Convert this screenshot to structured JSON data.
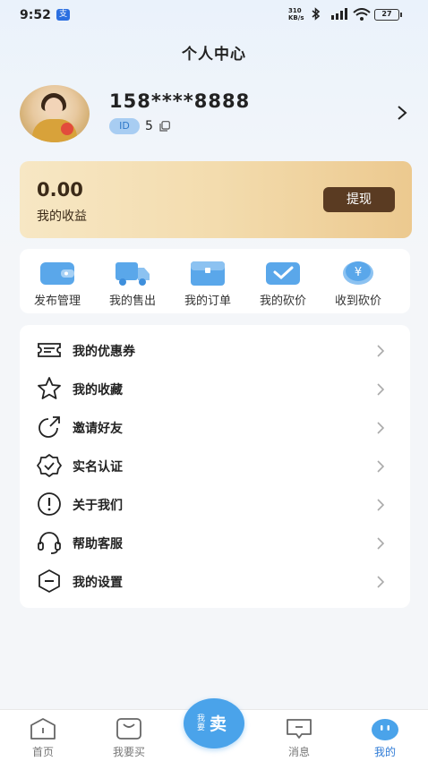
{
  "status": {
    "time": "9:52",
    "net_speed_top": "310",
    "net_speed_bottom": "KB/s",
    "battery": "27"
  },
  "page_title": "个人中心",
  "profile": {
    "phone": "158****8888",
    "id_label": "ID",
    "id_value": "5"
  },
  "earnings": {
    "amount": "0.00",
    "label": "我的收益",
    "withdraw": "提现"
  },
  "quick_actions": [
    {
      "label": "发布管理",
      "icon": "wallet-icon"
    },
    {
      "label": "我的售出",
      "icon": "truck-icon"
    },
    {
      "label": "我的订单",
      "icon": "box-icon"
    },
    {
      "label": "我的砍价",
      "icon": "check-folder-icon"
    },
    {
      "label": "收到砍价",
      "icon": "yen-coin-icon"
    }
  ],
  "menu": [
    {
      "label": "我的优惠券",
      "icon": "coupon-icon"
    },
    {
      "label": "我的收藏",
      "icon": "star-icon"
    },
    {
      "label": "邀请好友",
      "icon": "share-icon"
    },
    {
      "label": "实名认证",
      "icon": "verified-badge-icon"
    },
    {
      "label": "关于我们",
      "icon": "info-icon"
    },
    {
      "label": "帮助客服",
      "icon": "headset-icon"
    },
    {
      "label": "我的设置",
      "icon": "settings-hexagon-icon"
    }
  ],
  "tabbar": {
    "home": "首页",
    "buy": "我要买",
    "sell_small": "我要",
    "sell_big": "卖",
    "messages": "消息",
    "mine": "我的"
  },
  "colors": {
    "accent": "#2f7bd6",
    "sell_button": "#4aa3ea",
    "withdraw_button": "#5a3b22",
    "earnings_bg": "#f3dcae"
  }
}
